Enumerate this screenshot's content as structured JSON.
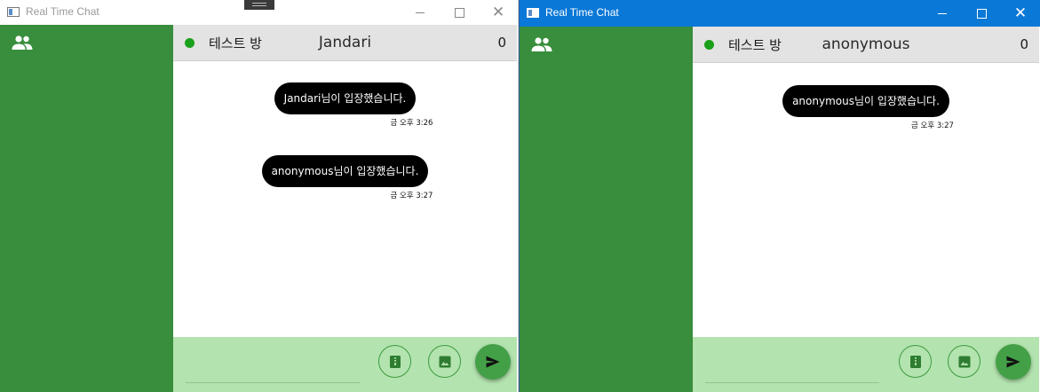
{
  "windows": [
    {
      "title": "Real Time Chat",
      "room": {
        "name": "테스트 방",
        "user": "Jandari",
        "count": "0"
      },
      "messages": [
        {
          "text": "Jandari님이 입장했습니다.",
          "time": "금 오후 3:26"
        },
        {
          "text": "anonymous님이 입장했습니다.",
          "time": "금 오후 3:27"
        }
      ],
      "composer": {
        "input_value": ""
      }
    },
    {
      "title": "Real Time Chat",
      "room": {
        "name": "테스트 방",
        "user": "anonymous",
        "count": "0"
      },
      "messages": [
        {
          "text": "anonymous님이 입장했습니다.",
          "time": "금 오후 3:27"
        }
      ],
      "composer": {
        "input_value": ""
      }
    }
  ],
  "icons": {
    "sidebar": "people-icon",
    "file": "file-icon",
    "image": "image-icon",
    "send": "send-icon",
    "status": "online-status-dot"
  },
  "colors": {
    "sidebar": "#388e3c",
    "header": "#e3e3e3",
    "composer": "#b3e3ae",
    "bubble": "#000000",
    "send_button": "#43a047",
    "online": "#1aa01a",
    "active_titlebar": "#0a78d7"
  }
}
